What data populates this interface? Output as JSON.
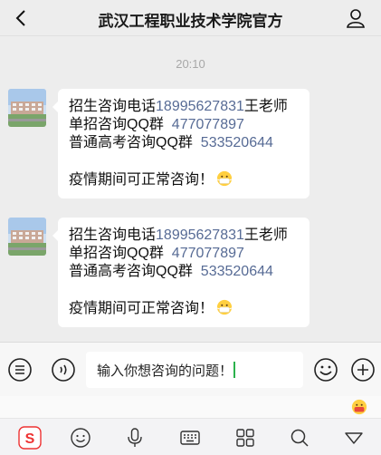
{
  "header": {
    "title": "武汉工程职业技术学院官方",
    "back_icon": "chevron-left-icon",
    "profile_icon": "person-icon"
  },
  "chat": {
    "timestamp": "20:10",
    "messages": [
      {
        "sender_avatar": "campus-building-photo",
        "lines": [
          {
            "prefix": "招生咨询电话",
            "link": "18995627831",
            "suffix": "王老师"
          },
          {
            "prefix": "单招咨询QQ群  ",
            "link": "477077897",
            "suffix": ""
          },
          {
            "prefix": "普通高考咨询QQ群  ",
            "link": "533520644",
            "suffix": ""
          }
        ],
        "closing": "疫情期间可正常咨询！",
        "closing_emoji": "mask-face-emoji"
      },
      {
        "sender_avatar": "campus-building-photo",
        "lines": [
          {
            "prefix": "招生咨询电话",
            "link": "18995627831",
            "suffix": "王老师"
          },
          {
            "prefix": "单招咨询QQ群  ",
            "link": "477077897",
            "suffix": ""
          },
          {
            "prefix": "普通高考咨询QQ群  ",
            "link": "533520644",
            "suffix": ""
          }
        ],
        "closing": "疫情期间可正常咨询！",
        "closing_emoji": "mask-face-emoji"
      }
    ]
  },
  "input_bar": {
    "menu_icon": "menu-list-icon",
    "voice_icon": "voice-icon",
    "input_value": "输入你想咨询的问题！",
    "emoji_icon": "smiley-icon",
    "plus_icon": "plus-circle-icon"
  },
  "keyboard_toolbar": {
    "icons": [
      "sogou-logo-icon",
      "emoji-face-icon",
      "microphone-icon",
      "keyboard-icon",
      "grid-apps-icon",
      "search-icon",
      "collapse-down-icon"
    ]
  },
  "colors": {
    "link": "#576b95",
    "caret": "#2bb24c",
    "background": "#ededed"
  }
}
